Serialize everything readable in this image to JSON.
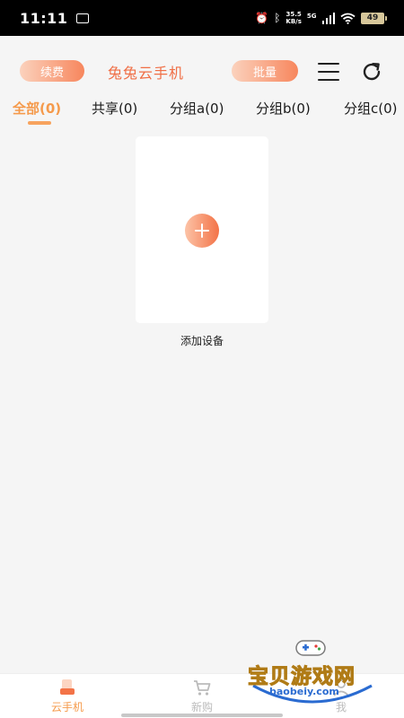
{
  "status_bar": {
    "time": "11:11",
    "net_speed_value": "35.5",
    "net_speed_unit": "KB/s",
    "network_type": "5G",
    "battery": "49"
  },
  "header": {
    "renew_label": "续费",
    "title": "兔兔云手机",
    "batch_label": "批量",
    "menu_icon": "menu-icon",
    "refresh_icon": "refresh-icon"
  },
  "tabs": [
    {
      "label": "全部(0)",
      "active": true
    },
    {
      "label": "共享(0)",
      "active": false
    },
    {
      "label": "分组a(0)",
      "active": false
    },
    {
      "label": "分组b(0)",
      "active": false
    },
    {
      "label": "分组c(0)",
      "active": false
    }
  ],
  "device_area": {
    "add_device_label": "添加设备"
  },
  "bottom_nav": {
    "items": [
      {
        "label": "云手机",
        "icon": "cloud-phone-icon",
        "active": true
      },
      {
        "label": "新购",
        "icon": "cart-icon",
        "active": false
      },
      {
        "label": "我",
        "icon": "profile-icon",
        "active": false
      }
    ]
  },
  "watermark": {
    "text": "宝贝游戏网",
    "url": "baobeiy.com"
  },
  "colors": {
    "accent": "#f59a4b",
    "title": "#f06e45",
    "gradient_start": "#fbd2bd",
    "gradient_end": "#f7865d",
    "background": "#f5f5f5"
  }
}
